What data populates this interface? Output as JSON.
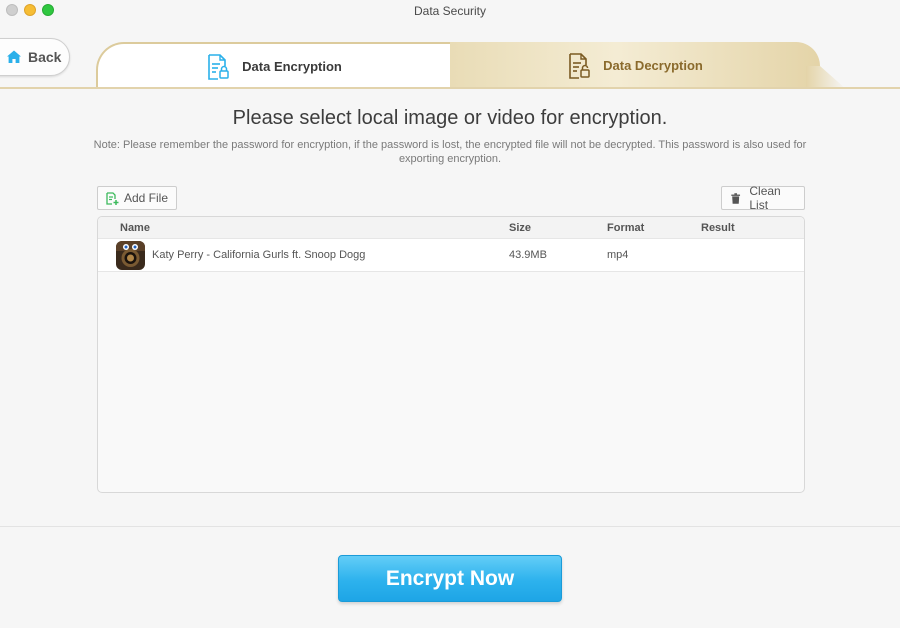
{
  "window": {
    "title": "Data Security"
  },
  "header": {
    "back_label": "Back",
    "tabs": [
      {
        "label": "Data Encryption",
        "icon": "encrypt-document-icon",
        "active": true
      },
      {
        "label": "Data Decryption",
        "icon": "decrypt-document-icon",
        "active": false
      }
    ]
  },
  "main": {
    "heading": "Please select local image or video for encryption.",
    "note": "Note: Please remember the password for encryption, if the password is lost, the encrypted file will not be decrypted. This password is also used for exporting encryption.",
    "add_file_label": "Add File",
    "clean_list_label": "Clean List",
    "table": {
      "columns": [
        "Name",
        "Size",
        "Format",
        "Result"
      ],
      "rows": [
        {
          "name": "Katy Perry - California Gurls ft. Snoop Dogg",
          "size": "43.9MB",
          "format": "mp4",
          "result": ""
        }
      ]
    },
    "encrypt_label": "Encrypt Now"
  },
  "colors": {
    "accent": "#2db2ed",
    "gold": "#dccb9c",
    "add_icon": "#3cba5c"
  }
}
